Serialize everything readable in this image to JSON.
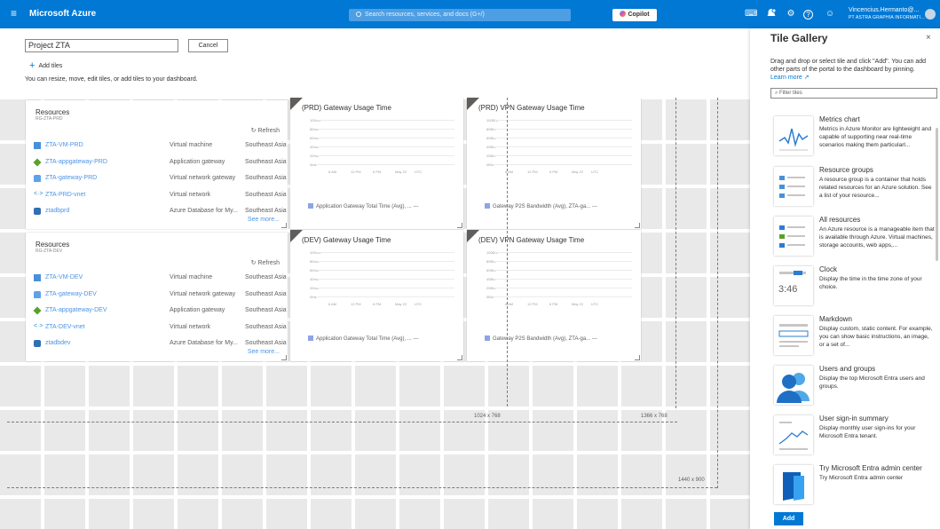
{
  "topbar": {
    "brand": "Microsoft Azure",
    "search_placeholder": "Search resources, services, and docs (G+/)",
    "copilot": "Copilot",
    "user_name": "Vincencius.Hermanto@...",
    "user_org": "PT ASTRA GRAPHIA INFORMATI...",
    "hamburger": "≡",
    "shell": "⌨",
    "gear": "⚙",
    "help": "?",
    "feedback": "☺"
  },
  "header": {
    "dashboard_name": "Project ZTA",
    "cancel": "Cancel",
    "add_tiles": "Add tiles",
    "hint": "You can resize, move, edit tiles, or add tiles to your dashboard."
  },
  "resources_prd": {
    "title": "Resources",
    "subtitle": "RG-ZTA-PRD",
    "refresh": "Refresh",
    "see_more": "See more...",
    "rows": [
      {
        "name": "ZTA-VM-PRD",
        "type": "Virtual machine",
        "location": "Southeast Asia"
      },
      {
        "name": "ZTA-appgateway-PRD",
        "type": "Application gateway",
        "location": "Southeast Asia"
      },
      {
        "name": "ZTA-gateway-PRD",
        "type": "Virtual network gateway",
        "location": "Southeast Asia"
      },
      {
        "name": "ZTA-PRD-vnet",
        "type": "Virtual network",
        "location": "Southeast Asia"
      },
      {
        "name": "ztadbprd",
        "type": "Azure Database for My...",
        "location": "Southeast Asia"
      }
    ]
  },
  "resources_dev": {
    "title": "Resources",
    "subtitle": "RG-ZTA-DEV",
    "refresh": "Refresh",
    "see_more": "See more...",
    "rows": [
      {
        "name": "ZTA-VM-DEV",
        "type": "Virtual machine",
        "location": "Southeast Asia"
      },
      {
        "name": "ZTA-gateway-DEV",
        "type": "Virtual network gateway",
        "location": "Southeast Asia"
      },
      {
        "name": "ZTA-appgateway-DEV",
        "type": "Application gateway",
        "location": "Southeast Asia"
      },
      {
        "name": "ZTA-DEV-vnet",
        "type": "Virtual network",
        "location": "Southeast Asia"
      },
      {
        "name": "ztadbdev",
        "type": "Azure Database for My...",
        "location": "Southeast Asia"
      }
    ]
  },
  "charts": [
    {
      "title": "(PRD) Gateway Usage Time",
      "y_ticks": [
        "100ms",
        "80ms",
        "60ms",
        "40ms",
        "20ms",
        "0ms"
      ],
      "x_ticks": [
        "6 AM",
        "12 PM",
        "6 PM",
        "May 22",
        "UTC"
      ],
      "legend": "Application Gateway Total Time (Avg), ...",
      "more": "---"
    },
    {
      "title": "(PRD) VPN Gateway Usage Time",
      "y_ticks": [
        "100B/s",
        "80B/s",
        "60B/s",
        "40B/s",
        "20B/s",
        "0B/s"
      ],
      "x_ticks": [
        "6 AM",
        "12 PM",
        "6 PM",
        "May 22",
        "UTC"
      ],
      "legend": "Gateway P2S Bandwidth (Avg), ZTA-ga...",
      "more": "---"
    },
    {
      "title": "(DEV) Gateway Usage Time",
      "y_ticks": [
        "100ms",
        "80ms",
        "60ms",
        "40ms",
        "20ms",
        "0ms"
      ],
      "x_ticks": [
        "6 AM",
        "12 PM",
        "6 PM",
        "May 22",
        "UTC"
      ],
      "legend": "Application Gateway Total Time (Avg), ...",
      "more": "---"
    },
    {
      "title": "(DEV) VPN Gateway Usage Time",
      "y_ticks": [
        "100B/s",
        "80B/s",
        "60B/s",
        "40B/s",
        "20B/s",
        "0B/s"
      ],
      "x_ticks": [
        "6 AM",
        "12 PM",
        "6 PM",
        "May 22",
        "UTC"
      ],
      "legend": "Gateway P2S Bandwidth (Avg), ZTA-ga...",
      "more": "---"
    }
  ],
  "resolution_labels": [
    "1024 x 768",
    "1366 x 768",
    "1440 x 900"
  ],
  "gallery": {
    "title": "Tile Gallery",
    "close": "×",
    "description": "Drag and drop or select tile and click \"Add\". You can add other parts of the portal to the dashboard by pinning.",
    "learn_more": "Learn more ↗",
    "filter_placeholder": "Filter tiles",
    "add": "Add",
    "clock_time": "3:46",
    "items": [
      {
        "title": "Metrics chart",
        "desc": "Metrics in Azure Monitor are lightweight and capable of supporting near real-time scenarios making them particularl..."
      },
      {
        "title": "Resource groups",
        "desc": "A resource group is a container that holds related resources for an Azure solution. See a list of your resource..."
      },
      {
        "title": "All resources",
        "desc": "An Azure resource is a manageable item that is available through Azure. Virtual machines, storage accounts, web apps,..."
      },
      {
        "title": "Clock",
        "desc": "Display the time in the time zone of your choice."
      },
      {
        "title": "Markdown",
        "desc": "Display custom, static content. For example, you can show basic instructions, an image, or a set of..."
      },
      {
        "title": "Users and groups",
        "desc": "Display the top Microsoft Entra users and groups."
      },
      {
        "title": "User sign-in summary",
        "desc": "Display monthly user sign-ins for your Microsoft Entra tenant."
      },
      {
        "title": "Try Microsoft Entra admin center",
        "desc": "Try Microsoft Entra admin center"
      }
    ]
  }
}
